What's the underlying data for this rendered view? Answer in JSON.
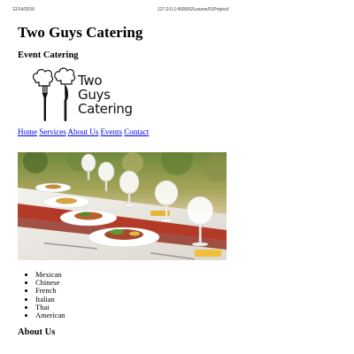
{
  "print_header": {
    "date": "12/14/2016",
    "url": "127.0.0.1:4000/02Lesson/01Project/"
  },
  "page": {
    "title": "Two Guys Catering",
    "subtitle": "Event Catering",
    "logo": {
      "line1": "Two",
      "line2": "Guys",
      "line3": "Catering",
      "icon": "chef-hats-fork-knife-icon"
    },
    "nav": {
      "home": "Home",
      "services": "Services",
      "about": "About Us",
      "events": "Events",
      "contact": "Contact"
    },
    "hero_image": "banquet-table-photo",
    "cuisines": [
      "Mexican",
      "Chinese",
      "French",
      "Italian",
      "Thai",
      "American"
    ],
    "about_heading": "About Us"
  }
}
